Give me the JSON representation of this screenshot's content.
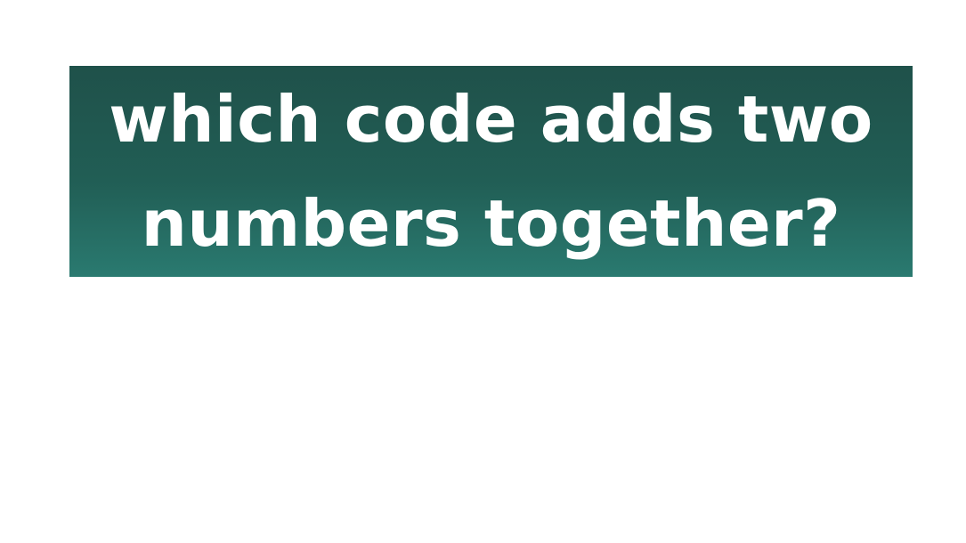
{
  "question": {
    "text": "which code adds two numbers together?"
  },
  "colors": {
    "banner_top": "#1f514a",
    "banner_bottom": "#2a7a70",
    "text": "#ffffff",
    "background": "#ffffff"
  }
}
